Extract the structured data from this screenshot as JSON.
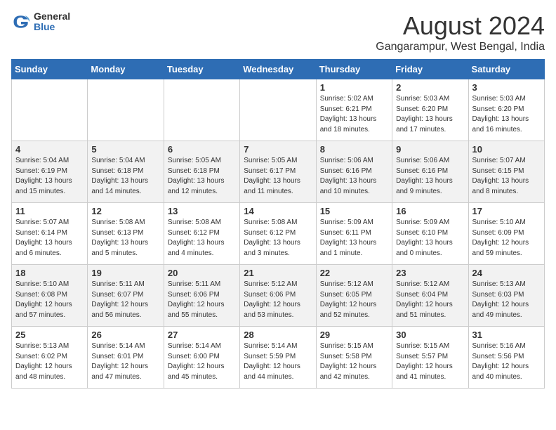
{
  "logo": {
    "general": "General",
    "blue": "Blue"
  },
  "title": "August 2024",
  "location": "Gangarampur, West Bengal, India",
  "weekdays": [
    "Sunday",
    "Monday",
    "Tuesday",
    "Wednesday",
    "Thursday",
    "Friday",
    "Saturday"
  ],
  "weeks": [
    [
      {
        "day": "",
        "info": ""
      },
      {
        "day": "",
        "info": ""
      },
      {
        "day": "",
        "info": ""
      },
      {
        "day": "",
        "info": ""
      },
      {
        "day": "1",
        "info": "Sunrise: 5:02 AM\nSunset: 6:21 PM\nDaylight: 13 hours\nand 18 minutes."
      },
      {
        "day": "2",
        "info": "Sunrise: 5:03 AM\nSunset: 6:20 PM\nDaylight: 13 hours\nand 17 minutes."
      },
      {
        "day": "3",
        "info": "Sunrise: 5:03 AM\nSunset: 6:20 PM\nDaylight: 13 hours\nand 16 minutes."
      }
    ],
    [
      {
        "day": "4",
        "info": "Sunrise: 5:04 AM\nSunset: 6:19 PM\nDaylight: 13 hours\nand 15 minutes."
      },
      {
        "day": "5",
        "info": "Sunrise: 5:04 AM\nSunset: 6:18 PM\nDaylight: 13 hours\nand 14 minutes."
      },
      {
        "day": "6",
        "info": "Sunrise: 5:05 AM\nSunset: 6:18 PM\nDaylight: 13 hours\nand 12 minutes."
      },
      {
        "day": "7",
        "info": "Sunrise: 5:05 AM\nSunset: 6:17 PM\nDaylight: 13 hours\nand 11 minutes."
      },
      {
        "day": "8",
        "info": "Sunrise: 5:06 AM\nSunset: 6:16 PM\nDaylight: 13 hours\nand 10 minutes."
      },
      {
        "day": "9",
        "info": "Sunrise: 5:06 AM\nSunset: 6:16 PM\nDaylight: 13 hours\nand 9 minutes."
      },
      {
        "day": "10",
        "info": "Sunrise: 5:07 AM\nSunset: 6:15 PM\nDaylight: 13 hours\nand 8 minutes."
      }
    ],
    [
      {
        "day": "11",
        "info": "Sunrise: 5:07 AM\nSunset: 6:14 PM\nDaylight: 13 hours\nand 6 minutes."
      },
      {
        "day": "12",
        "info": "Sunrise: 5:08 AM\nSunset: 6:13 PM\nDaylight: 13 hours\nand 5 minutes."
      },
      {
        "day": "13",
        "info": "Sunrise: 5:08 AM\nSunset: 6:12 PM\nDaylight: 13 hours\nand 4 minutes."
      },
      {
        "day": "14",
        "info": "Sunrise: 5:08 AM\nSunset: 6:12 PM\nDaylight: 13 hours\nand 3 minutes."
      },
      {
        "day": "15",
        "info": "Sunrise: 5:09 AM\nSunset: 6:11 PM\nDaylight: 13 hours\nand 1 minute."
      },
      {
        "day": "16",
        "info": "Sunrise: 5:09 AM\nSunset: 6:10 PM\nDaylight: 13 hours\nand 0 minutes."
      },
      {
        "day": "17",
        "info": "Sunrise: 5:10 AM\nSunset: 6:09 PM\nDaylight: 12 hours\nand 59 minutes."
      }
    ],
    [
      {
        "day": "18",
        "info": "Sunrise: 5:10 AM\nSunset: 6:08 PM\nDaylight: 12 hours\nand 57 minutes."
      },
      {
        "day": "19",
        "info": "Sunrise: 5:11 AM\nSunset: 6:07 PM\nDaylight: 12 hours\nand 56 minutes."
      },
      {
        "day": "20",
        "info": "Sunrise: 5:11 AM\nSunset: 6:06 PM\nDaylight: 12 hours\nand 55 minutes."
      },
      {
        "day": "21",
        "info": "Sunrise: 5:12 AM\nSunset: 6:06 PM\nDaylight: 12 hours\nand 53 minutes."
      },
      {
        "day": "22",
        "info": "Sunrise: 5:12 AM\nSunset: 6:05 PM\nDaylight: 12 hours\nand 52 minutes."
      },
      {
        "day": "23",
        "info": "Sunrise: 5:12 AM\nSunset: 6:04 PM\nDaylight: 12 hours\nand 51 minutes."
      },
      {
        "day": "24",
        "info": "Sunrise: 5:13 AM\nSunset: 6:03 PM\nDaylight: 12 hours\nand 49 minutes."
      }
    ],
    [
      {
        "day": "25",
        "info": "Sunrise: 5:13 AM\nSunset: 6:02 PM\nDaylight: 12 hours\nand 48 minutes."
      },
      {
        "day": "26",
        "info": "Sunrise: 5:14 AM\nSunset: 6:01 PM\nDaylight: 12 hours\nand 47 minutes."
      },
      {
        "day": "27",
        "info": "Sunrise: 5:14 AM\nSunset: 6:00 PM\nDaylight: 12 hours\nand 45 minutes."
      },
      {
        "day": "28",
        "info": "Sunrise: 5:14 AM\nSunset: 5:59 PM\nDaylight: 12 hours\nand 44 minutes."
      },
      {
        "day": "29",
        "info": "Sunrise: 5:15 AM\nSunset: 5:58 PM\nDaylight: 12 hours\nand 42 minutes."
      },
      {
        "day": "30",
        "info": "Sunrise: 5:15 AM\nSunset: 5:57 PM\nDaylight: 12 hours\nand 41 minutes."
      },
      {
        "day": "31",
        "info": "Sunrise: 5:16 AM\nSunset: 5:56 PM\nDaylight: 12 hours\nand 40 minutes."
      }
    ]
  ]
}
